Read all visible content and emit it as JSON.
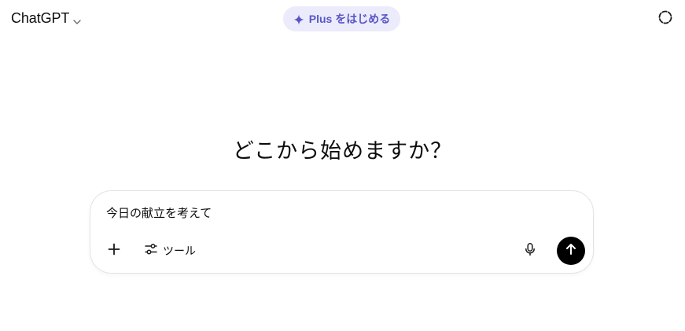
{
  "header": {
    "model_name": "ChatGPT",
    "plus_label": "Plus をはじめる"
  },
  "main": {
    "heading": "どこから始めますか？"
  },
  "composer": {
    "input_value": "今日の献立を考えて",
    "tools_label": "ツール"
  },
  "colors": {
    "plus_pill_bg": "#ecebfb",
    "plus_pill_text": "#5856c7",
    "send_button_bg": "#000000"
  },
  "icons": {
    "model_chevron": "chevron-down-icon",
    "plus_spark": "sparkle-icon",
    "temp_chat": "dashed-circle-icon",
    "add": "plus-icon",
    "tools": "sliders-icon",
    "mic": "microphone-icon",
    "send": "arrow-up-icon"
  }
}
